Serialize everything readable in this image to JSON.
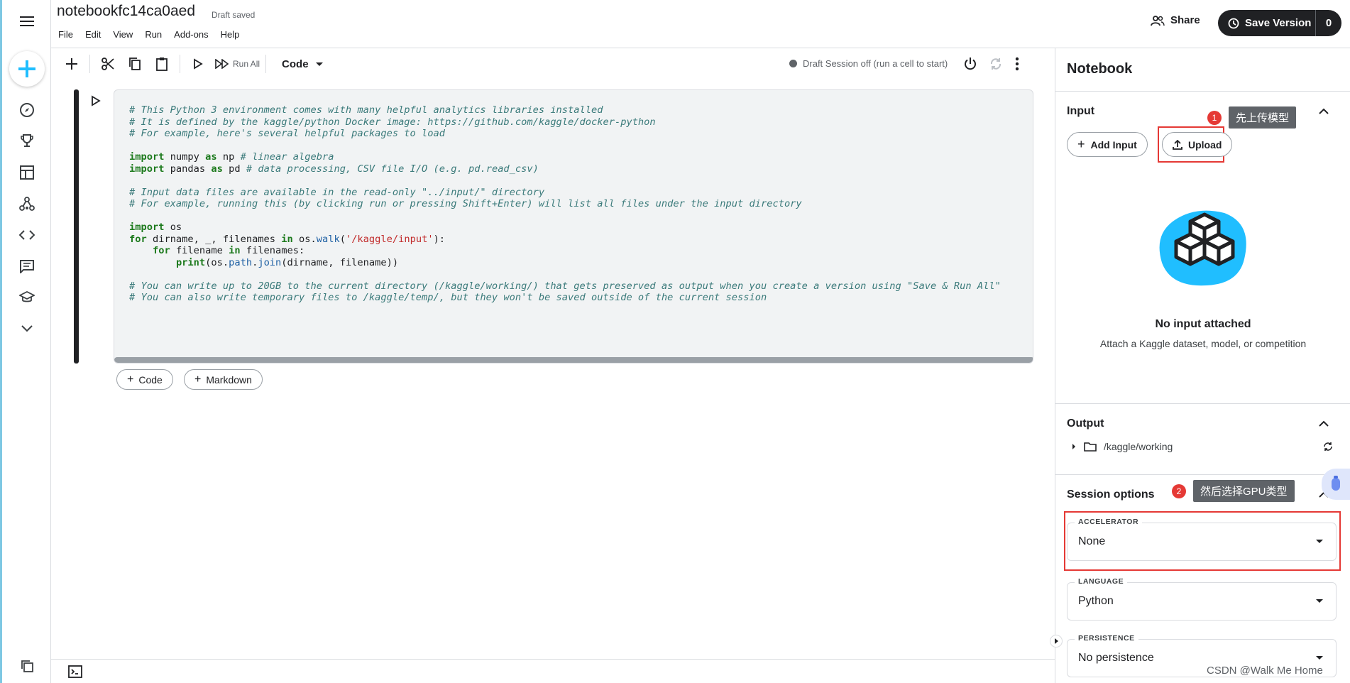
{
  "app": {
    "notebook_title": "notebookfc14ca0aed",
    "draft_status": "Draft saved",
    "menu": [
      "File",
      "Edit",
      "View",
      "Run",
      "Add-ons",
      "Help"
    ],
    "share_label": "Share",
    "save_version_label": "Save Version",
    "save_version_count": "0"
  },
  "toolbar": {
    "run_all_label": "Run All",
    "cell_type": "Code",
    "session_status": "Draft Session off (run a cell to start)"
  },
  "cell": {
    "code_lines": [
      [
        [
          "c-cm",
          "# This Python 3 environment comes with many helpful analytics libraries installed"
        ]
      ],
      [
        [
          "c-cm",
          "# It is defined by the kaggle/python Docker image: https://github.com/kaggle/docker-python"
        ]
      ],
      [
        [
          "c-cm",
          "# For example, here's several helpful packages to load"
        ]
      ],
      [],
      [
        [
          "c-kw",
          "import"
        ],
        [
          "",
          " numpy "
        ],
        [
          "c-kw",
          "as"
        ],
        [
          "",
          " np "
        ],
        [
          "c-cm",
          "# linear algebra"
        ]
      ],
      [
        [
          "c-kw",
          "import"
        ],
        [
          "",
          " pandas "
        ],
        [
          "c-kw",
          "as"
        ],
        [
          "",
          " pd "
        ],
        [
          "c-cm",
          "# data processing, CSV file I/O (e.g. pd.read_csv)"
        ]
      ],
      [],
      [
        [
          "c-cm",
          "# Input data files are available in the read-only \"../input/\" directory"
        ]
      ],
      [
        [
          "c-cm",
          "# For example, running this (by clicking run or pressing Shift+Enter) will list all files under the input directory"
        ]
      ],
      [],
      [
        [
          "c-kw",
          "import"
        ],
        [
          "",
          " os"
        ]
      ],
      [
        [
          "c-kw",
          "for"
        ],
        [
          "",
          " dirname, _, filenames "
        ],
        [
          "c-kw",
          "in"
        ],
        [
          "",
          " os."
        ],
        [
          "c-fn",
          "walk"
        ],
        [
          "",
          "("
        ],
        [
          "c-str",
          "'/kaggle/input'"
        ],
        [
          "",
          "):"
        ]
      ],
      [
        [
          "",
          "    "
        ],
        [
          "c-kw",
          "for"
        ],
        [
          "",
          " filename "
        ],
        [
          "c-kw",
          "in"
        ],
        [
          "",
          " filenames:"
        ]
      ],
      [
        [
          "",
          "        "
        ],
        [
          "c-kw",
          "print"
        ],
        [
          "",
          "(os."
        ],
        [
          "c-fn",
          "path"
        ],
        [
          "",
          "."
        ],
        [
          "c-fn",
          "join"
        ],
        [
          "",
          "(dirname, filename))"
        ]
      ],
      [],
      [
        [
          "c-cm",
          "# You can write up to 20GB to the current directory (/kaggle/working/) that gets preserved as output when you create a version using \"Save & Run All\""
        ]
      ],
      [
        [
          "c-cm",
          "# You can also write temporary files to /kaggle/temp/, but they won't be saved outside of the current session"
        ]
      ]
    ],
    "add_code_label": "Code",
    "add_markdown_label": "Markdown"
  },
  "panel": {
    "title": "Notebook",
    "input": {
      "title": "Input",
      "add_input_label": "Add Input",
      "upload_label": "Upload",
      "empty_title": "No input attached",
      "empty_subtitle": "Attach a Kaggle dataset, model, or competition"
    },
    "output": {
      "title": "Output",
      "folder": "/kaggle/working"
    },
    "session": {
      "title": "Session options",
      "accelerator_label": "ACCELERATOR",
      "accelerator_value": "None",
      "language_label": "LANGUAGE",
      "language_value": "Python",
      "persistence_label": "PERSISTENCE",
      "persistence_value": "No persistence"
    }
  },
  "annotations": [
    {
      "badge": "1",
      "text": "先上传模型"
    },
    {
      "badge": "2",
      "text": "然后选择GPU类型"
    }
  ],
  "watermark": "CSDN @Walk Me Home",
  "colors": {
    "accent": "#20beff",
    "annotation_red": "#e53935",
    "dark_button": "#202124"
  }
}
